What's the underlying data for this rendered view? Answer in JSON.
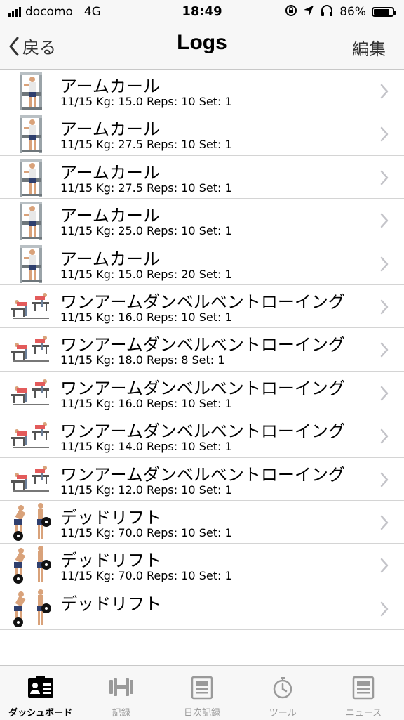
{
  "status": {
    "carrier": "docomo",
    "network": "4G",
    "time": "18:49",
    "battery": "86%",
    "battery_level": 0.86
  },
  "nav": {
    "back_label": "戻る",
    "title": "Logs",
    "edit_label": "編集"
  },
  "rows": [
    {
      "exercise": "arm-curl",
      "name": "アームカール",
      "detail": "11/15  Kg: 15.0  Reps: 10  Set: 1"
    },
    {
      "exercise": "arm-curl",
      "name": "アームカール",
      "detail": "11/15  Kg: 27.5  Reps: 10  Set: 1"
    },
    {
      "exercise": "arm-curl",
      "name": "アームカール",
      "detail": "11/15  Kg: 27.5  Reps: 10  Set: 1"
    },
    {
      "exercise": "arm-curl",
      "name": "アームカール",
      "detail": "11/15  Kg: 25.0  Reps: 10  Set: 1"
    },
    {
      "exercise": "arm-curl",
      "name": "アームカール",
      "detail": "11/15  Kg: 15.0  Reps: 20  Set: 1"
    },
    {
      "exercise": "dumbbell-row",
      "name": "ワンアームダンベルベントローイング",
      "detail": "11/15  Kg: 16.0  Reps: 10  Set: 1"
    },
    {
      "exercise": "dumbbell-row",
      "name": "ワンアームダンベルベントローイング",
      "detail": "11/15  Kg: 18.0  Reps: 8  Set: 1"
    },
    {
      "exercise": "dumbbell-row",
      "name": "ワンアームダンベルベントローイング",
      "detail": "11/15  Kg: 16.0  Reps: 10  Set: 1"
    },
    {
      "exercise": "dumbbell-row",
      "name": "ワンアームダンベルベントローイング",
      "detail": "11/15  Kg: 14.0  Reps: 10  Set: 1"
    },
    {
      "exercise": "dumbbell-row",
      "name": "ワンアームダンベルベントローイング",
      "detail": "11/15  Kg: 12.0  Reps: 10  Set: 1"
    },
    {
      "exercise": "deadlift",
      "name": "デッドリフト",
      "detail": "11/15  Kg: 70.0  Reps: 10  Set: 1"
    },
    {
      "exercise": "deadlift",
      "name": "デッドリフト",
      "detail": "11/15  Kg: 70.0  Reps: 10  Set: 1"
    },
    {
      "exercise": "deadlift",
      "name": "デッドリフト",
      "detail": ""
    }
  ],
  "tabs": [
    {
      "label": "ダッシュボード",
      "icon": "dashboard-icon",
      "active": true
    },
    {
      "label": "記録",
      "icon": "dumbbell-icon",
      "active": false
    },
    {
      "label": "日次記録",
      "icon": "daily-log-icon",
      "active": false
    },
    {
      "label": "ツール",
      "icon": "stopwatch-icon",
      "active": false
    },
    {
      "label": "ニュース",
      "icon": "news-icon",
      "active": false
    }
  ]
}
